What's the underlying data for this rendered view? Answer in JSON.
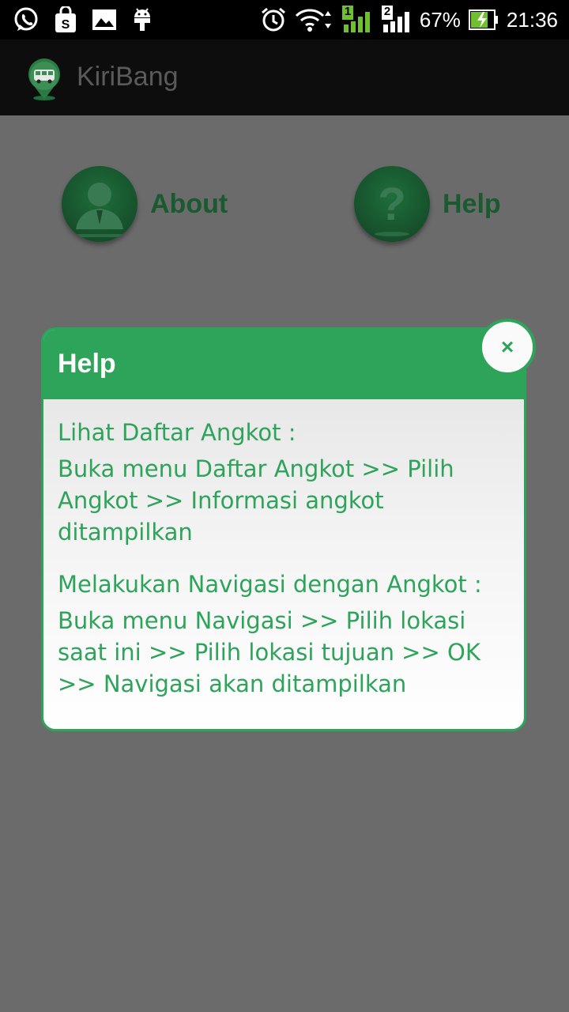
{
  "status_bar": {
    "battery_percent": "67%",
    "time": "21:36",
    "sim1_label": "1",
    "sim2_label": "2",
    "icons": [
      "whatsapp-icon",
      "shopping-bag-icon",
      "image-icon",
      "android-icon",
      "alarm-icon",
      "wifi-icon",
      "signal-sim1-icon",
      "signal-sim2-icon",
      "battery-charging-icon"
    ]
  },
  "app_bar": {
    "title": "KiriBang"
  },
  "menu": {
    "about_label": "About",
    "help_label": "Help"
  },
  "dialog": {
    "title": "Help",
    "close_label": "×",
    "sections": [
      {
        "heading": "Lihat Daftar Angkot :",
        "body": "Buka menu Daftar Angkot >> Pilih Angkot >> Informasi angkot ditampilkan"
      },
      {
        "heading": "Melakukan Navigasi dengan Angkot :",
        "body": "Buka menu Navigasi >> Pilih lokasi saat ini >> Pilih lokasi tujuan >> OK >> Navigasi akan ditampilkan"
      }
    ]
  },
  "colors": {
    "accent": "#2ea35a",
    "scrim": "#6b6b6b",
    "action_bar": "#0d0d0d"
  }
}
